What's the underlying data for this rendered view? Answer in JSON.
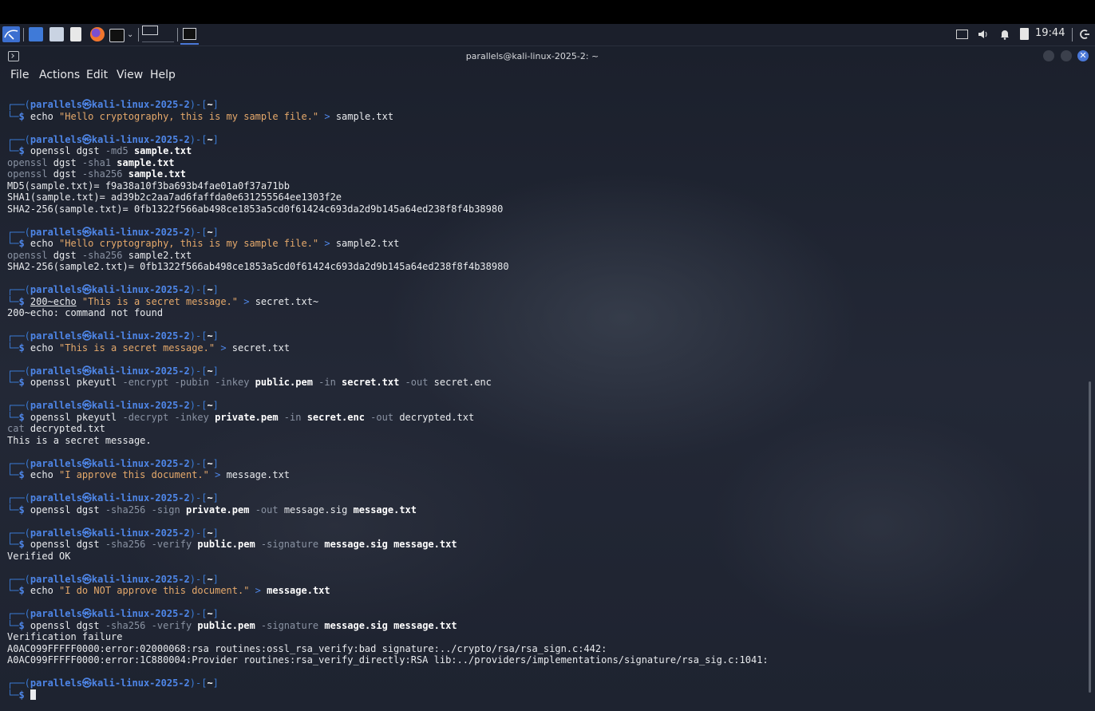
{
  "taskbar": {
    "clock": "19:44",
    "apps": [
      "kali-menu-icon",
      "files-icon",
      "folder-icon",
      "text-editor-icon",
      "firefox-icon",
      "terminal-icon",
      "terminal-window-icon"
    ]
  },
  "window": {
    "title": "parallels@kali-linux-2025-2: ~",
    "menu": [
      "File",
      "Actions",
      "Edit",
      "View",
      "Help"
    ]
  },
  "prompt": {
    "user": "parallels@kali-linux-2025-2",
    "dir": "~",
    "symbol": "$"
  },
  "lines": [
    {
      "t": "p"
    },
    {
      "t": "c",
      "parts": [
        [
          "",
          "echo "
        ],
        [
          "str",
          "\"Hello cryptography, this is my sample file.\""
        ],
        [
          "op",
          " > "
        ],
        [
          "",
          "sample.txt"
        ]
      ]
    },
    {
      "t": "blank"
    },
    {
      "t": "p"
    },
    {
      "t": "c",
      "parts": [
        [
          "",
          "openssl "
        ],
        [
          "",
          "dgst "
        ],
        [
          "kw",
          "-md5 "
        ],
        [
          "b",
          "sample.txt"
        ]
      ]
    },
    {
      "t": "o",
      "parts": [
        [
          "kw",
          "openssl "
        ],
        [
          "",
          "dgst "
        ],
        [
          "kw",
          "-sha1 "
        ],
        [
          "b",
          "sample.txt"
        ]
      ]
    },
    {
      "t": "o",
      "parts": [
        [
          "kw",
          "openssl "
        ],
        [
          "",
          "dgst "
        ],
        [
          "kw",
          "-sha256 "
        ],
        [
          "b",
          "sample.txt"
        ]
      ]
    },
    {
      "t": "o",
      "parts": [
        [
          "",
          "MD5(sample.txt)= f9a38a10f3ba693b4fae01a0f37a71bb"
        ]
      ]
    },
    {
      "t": "o",
      "parts": [
        [
          "",
          "SHA1(sample.txt)= ad39b2c2aa7ad6faffda0e631255564ee1303f2e"
        ]
      ]
    },
    {
      "t": "o",
      "parts": [
        [
          "",
          "SHA2-256(sample.txt)= 0fb1322f566ab498ce1853a5cd0f61424c693da2d9b145a64ed238f8f4b38980"
        ]
      ]
    },
    {
      "t": "blank"
    },
    {
      "t": "p"
    },
    {
      "t": "c",
      "parts": [
        [
          "",
          "echo "
        ],
        [
          "str",
          "\"Hello cryptography, this is my sample file.\""
        ],
        [
          "op",
          " > "
        ],
        [
          "",
          "sample2.txt"
        ]
      ]
    },
    {
      "t": "o",
      "parts": [
        [
          "kw",
          "openssl "
        ],
        [
          "",
          "dgst "
        ],
        [
          "kw",
          "-sha256 "
        ],
        [
          "",
          "sample2.txt"
        ]
      ]
    },
    {
      "t": "o",
      "parts": [
        [
          "",
          "SHA2-256(sample2.txt)= 0fb1322f566ab498ce1853a5cd0f61424c693da2d9b145a64ed238f8f4b38980"
        ]
      ]
    },
    {
      "t": "blank"
    },
    {
      "t": "p"
    },
    {
      "t": "c",
      "parts": [
        [
          "u",
          "200~echo"
        ],
        [
          "str",
          " \"This is a secret message.\""
        ],
        [
          "op",
          " > "
        ],
        [
          "",
          "secret.txt~"
        ]
      ]
    },
    {
      "t": "o",
      "parts": [
        [
          "",
          "200~echo: command not found"
        ]
      ]
    },
    {
      "t": "blank"
    },
    {
      "t": "p"
    },
    {
      "t": "c",
      "parts": [
        [
          "",
          "echo "
        ],
        [
          "str",
          "\"This is a secret message.\""
        ],
        [
          "op",
          " > "
        ],
        [
          "",
          "secret.txt"
        ]
      ]
    },
    {
      "t": "blank"
    },
    {
      "t": "p"
    },
    {
      "t": "c",
      "parts": [
        [
          "",
          "openssl "
        ],
        [
          "",
          "pkeyutl "
        ],
        [
          "kw",
          "-encrypt -pubin -inkey "
        ],
        [
          "b",
          "public.pem"
        ],
        [
          "kw",
          " -in "
        ],
        [
          "b",
          "secret.txt"
        ],
        [
          "kw",
          " -out "
        ],
        [
          "",
          "secret.enc"
        ]
      ]
    },
    {
      "t": "blank"
    },
    {
      "t": "p"
    },
    {
      "t": "c",
      "parts": [
        [
          "",
          "openssl "
        ],
        [
          "",
          "pkeyutl "
        ],
        [
          "kw",
          "-decrypt -inkey "
        ],
        [
          "b",
          "private.pem"
        ],
        [
          "kw",
          " -in "
        ],
        [
          "b",
          "secret.enc"
        ],
        [
          "kw",
          " -out "
        ],
        [
          "",
          "decrypted.txt"
        ]
      ]
    },
    {
      "t": "o",
      "parts": [
        [
          "kw",
          "cat "
        ],
        [
          "",
          "decrypted.txt"
        ]
      ]
    },
    {
      "t": "o",
      "parts": [
        [
          "",
          "This is a secret message."
        ]
      ]
    },
    {
      "t": "blank"
    },
    {
      "t": "p"
    },
    {
      "t": "c",
      "parts": [
        [
          "",
          "echo "
        ],
        [
          "str",
          "\"I approve this document.\""
        ],
        [
          "op",
          " > "
        ],
        [
          "",
          "message.txt"
        ]
      ]
    },
    {
      "t": "blank"
    },
    {
      "t": "p"
    },
    {
      "t": "c",
      "parts": [
        [
          "",
          "openssl "
        ],
        [
          "",
          "dgst "
        ],
        [
          "kw",
          "-sha256 -sign "
        ],
        [
          "b",
          "private.pem"
        ],
        [
          "kw",
          " -out "
        ],
        [
          "",
          "message.sig "
        ],
        [
          "b",
          "message.txt"
        ]
      ]
    },
    {
      "t": "blank"
    },
    {
      "t": "p"
    },
    {
      "t": "c",
      "parts": [
        [
          "",
          "openssl "
        ],
        [
          "",
          "dgst "
        ],
        [
          "kw",
          "-sha256 -verify "
        ],
        [
          "b",
          "public.pem"
        ],
        [
          "kw",
          " -signature "
        ],
        [
          "b",
          "message.sig message.txt"
        ]
      ]
    },
    {
      "t": "o",
      "parts": [
        [
          "",
          "Verified OK"
        ]
      ]
    },
    {
      "t": "blank"
    },
    {
      "t": "p"
    },
    {
      "t": "c",
      "parts": [
        [
          "",
          "echo "
        ],
        [
          "str",
          "\"I do NOT approve this document.\""
        ],
        [
          "op",
          " > "
        ],
        [
          "b",
          "message.txt"
        ]
      ]
    },
    {
      "t": "blank"
    },
    {
      "t": "p"
    },
    {
      "t": "c",
      "parts": [
        [
          "",
          "openssl "
        ],
        [
          "",
          "dgst "
        ],
        [
          "kw",
          "-sha256 -verify "
        ],
        [
          "b",
          "public.pem"
        ],
        [
          "kw",
          " -signature "
        ],
        [
          "b",
          "message.sig message.txt"
        ]
      ]
    },
    {
      "t": "o",
      "parts": [
        [
          "",
          "Verification failure"
        ]
      ]
    },
    {
      "t": "o",
      "parts": [
        [
          "",
          "A0AC099FFFFF0000:error:02000068:rsa routines:ossl_rsa_verify:bad signature:../crypto/rsa/rsa_sign.c:442:"
        ]
      ]
    },
    {
      "t": "o",
      "parts": [
        [
          "",
          "A0AC099FFFFF0000:error:1C880004:Provider routines:rsa_verify_directly:RSA lib:../providers/implementations/signature/rsa_sig.c:1041:"
        ]
      ]
    },
    {
      "t": "blank"
    },
    {
      "t": "p"
    },
    {
      "t": "cur"
    }
  ],
  "colors": {
    "prompt": "#4e86e8",
    "string": "#e5a96b",
    "flag": "#8a93a3",
    "text": "#e9ebee",
    "background": "#1d2230"
  }
}
